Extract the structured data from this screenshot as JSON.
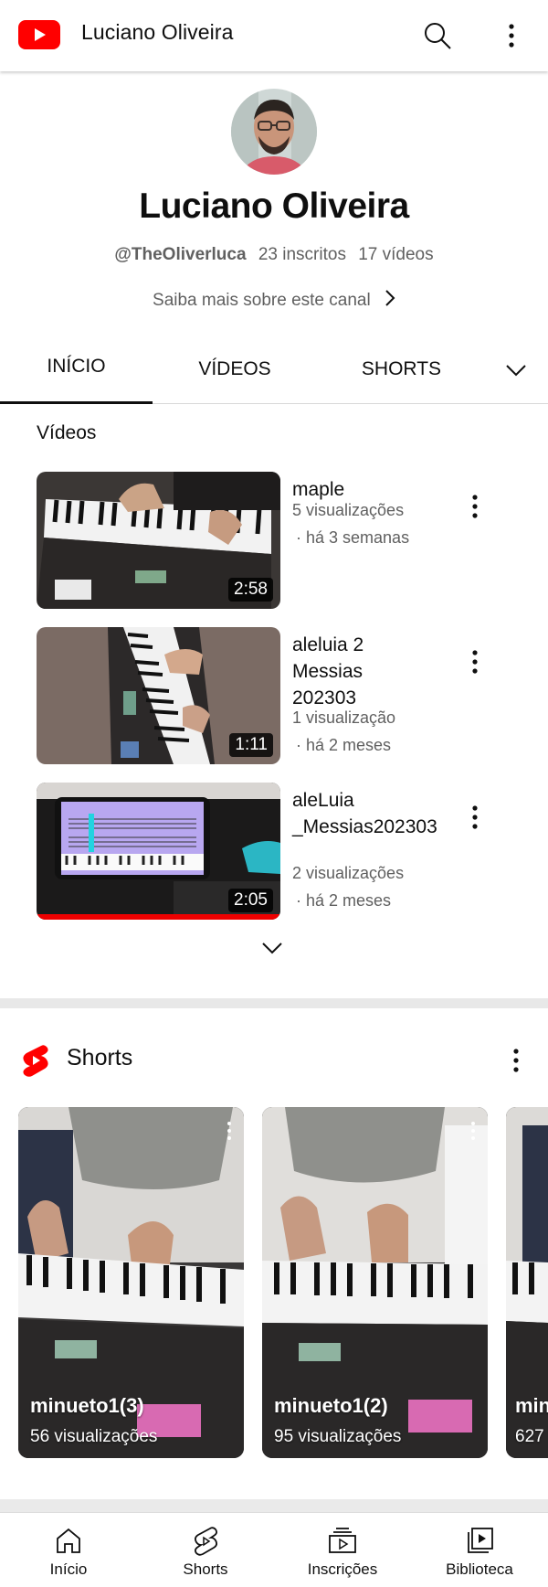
{
  "app": {
    "title": "Luciano Oliveira",
    "brand_color": "#ff0000"
  },
  "channel": {
    "name": "Luciano Oliveira",
    "handle": "@TheOliverluca",
    "subscribers": "23 inscritos",
    "videos_count": "17 vídeos",
    "about_link": "Saiba mais sobre este canal"
  },
  "tabs": [
    {
      "label": "INÍCIO",
      "selected": true
    },
    {
      "label": "VÍDEOS",
      "selected": false
    },
    {
      "label": "SHORTS",
      "selected": false
    }
  ],
  "videos_section": {
    "title": "Vídeos",
    "items": [
      {
        "title": "maple",
        "views": "5 visualizações",
        "date": "· há 3 semanas",
        "duration": "2:58",
        "watched_fraction": 0
      },
      {
        "title": "aleluia 2 Messias 202303",
        "views": "1 visualização",
        "date": "· há 2 meses",
        "duration": "1:11",
        "watched_fraction": 0
      },
      {
        "title": "aleLuia _Messias202303",
        "views": "2 visualizações",
        "date": "· há 2 meses",
        "duration": "2:05",
        "watched_fraction": 1
      }
    ]
  },
  "shorts_section": {
    "title": "Shorts",
    "items": [
      {
        "title": "minueto1(3)",
        "views": "56 visualizações"
      },
      {
        "title": "minueto1(2)",
        "views": "95 visualizações"
      },
      {
        "title": "min",
        "views": "627"
      }
    ]
  },
  "bottom_nav": [
    {
      "label": "Início",
      "icon": "home-icon"
    },
    {
      "label": "Shorts",
      "icon": "shorts-icon"
    },
    {
      "label": "Inscrições",
      "icon": "subscriptions-icon"
    },
    {
      "label": "Biblioteca",
      "icon": "library-icon"
    }
  ]
}
